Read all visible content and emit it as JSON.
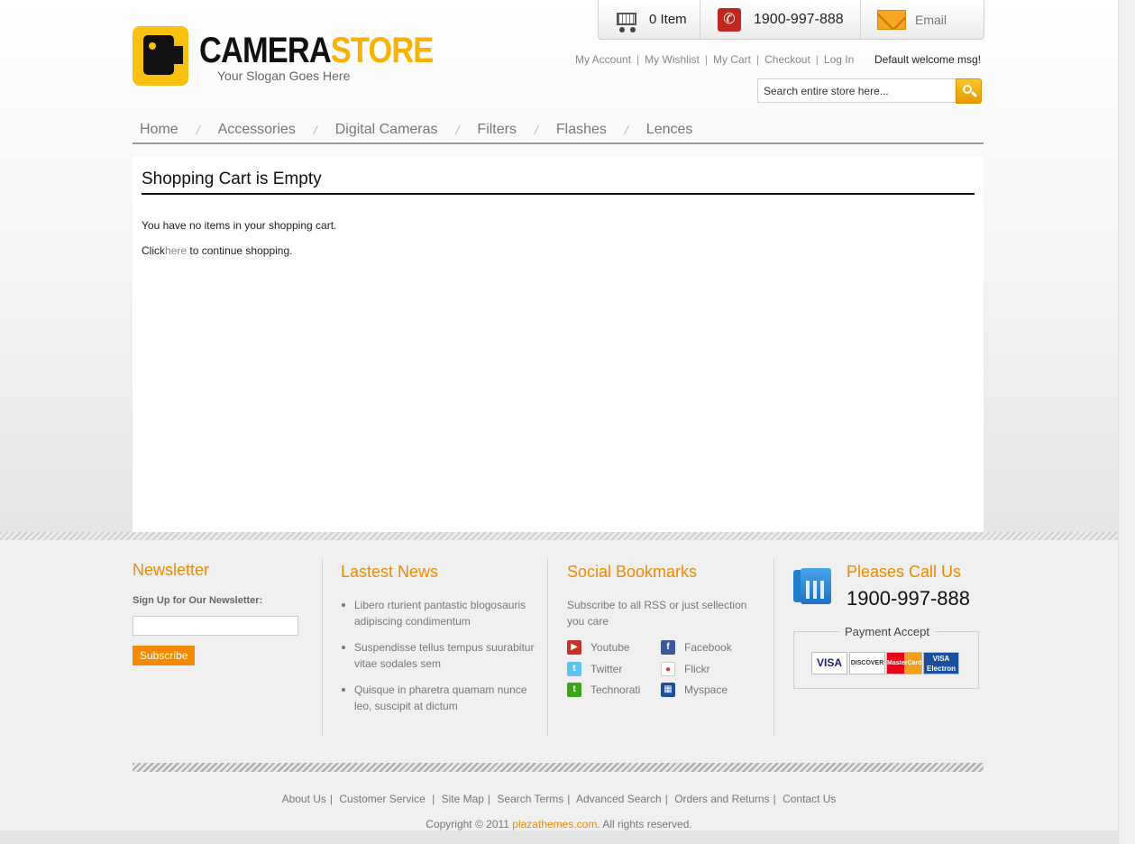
{
  "logo": {
    "title_a": "CAMERA",
    "title_b": "STORE",
    "slogan": "Your Slogan Goes Here"
  },
  "topbox": {
    "cart": "0 Item",
    "phone": "1900-997-888",
    "email": "Email"
  },
  "toplinks": [
    "My Account",
    "My Wishlist",
    "My Cart",
    "Checkout",
    "Log In"
  ],
  "welcome": "Default welcome msg!",
  "search": {
    "placeholder": "Search entire store here..."
  },
  "nav": [
    "Home",
    "Accessories",
    "Digital Cameras",
    "Filters",
    "Flashes",
    "Lences"
  ],
  "main": {
    "title": "Shopping Cart is Empty",
    "line1": "You have no items in your shopping cart.",
    "line2_pre": "Click",
    "line2_link": "here",
    "line2_post": "to continue shopping."
  },
  "footer": {
    "newsletter": {
      "title": "Newsletter",
      "label": "Sign Up for Our Newsletter:",
      "button": "Subscribe"
    },
    "news": {
      "title": "Lastest News",
      "items": [
        "Libero rturient pantastic blogosauris adipiscing condimentum",
        "Suspendisse tellus tempus suurabitur vitae sodales sem",
        "Quisque in pharetra quamam nunce leo, suscipit at dictum"
      ]
    },
    "social": {
      "title": "Social Bookmarks",
      "intro": "Subscribe to all RSS or just sellection you care",
      "items": [
        "Youtube",
        "Facebook",
        "Twitter",
        "Flickr",
        "Technorati",
        "Myspace"
      ]
    },
    "call": {
      "title": "Pleases Call Us",
      "phone": "1900-997-888",
      "payment_title": "Payment Accept"
    },
    "cards": [
      "VISA",
      "DISCOVER",
      "MasterCard",
      "VISA Electron"
    ],
    "links": [
      "About Us",
      "Customer Service",
      "Site Map",
      "Search Terms",
      "Advanced Search",
      "Orders and Returns",
      "Contact Us"
    ],
    "copyright_pre": "Copyright © 2011",
    "copyright_org": "plazathemes.com",
    "copyright_post": ". All rights reserved."
  },
  "colors": {
    "accent": "#f08a00",
    "logo_yellow": "#f9c010",
    "phone_red": "#c0271e"
  }
}
